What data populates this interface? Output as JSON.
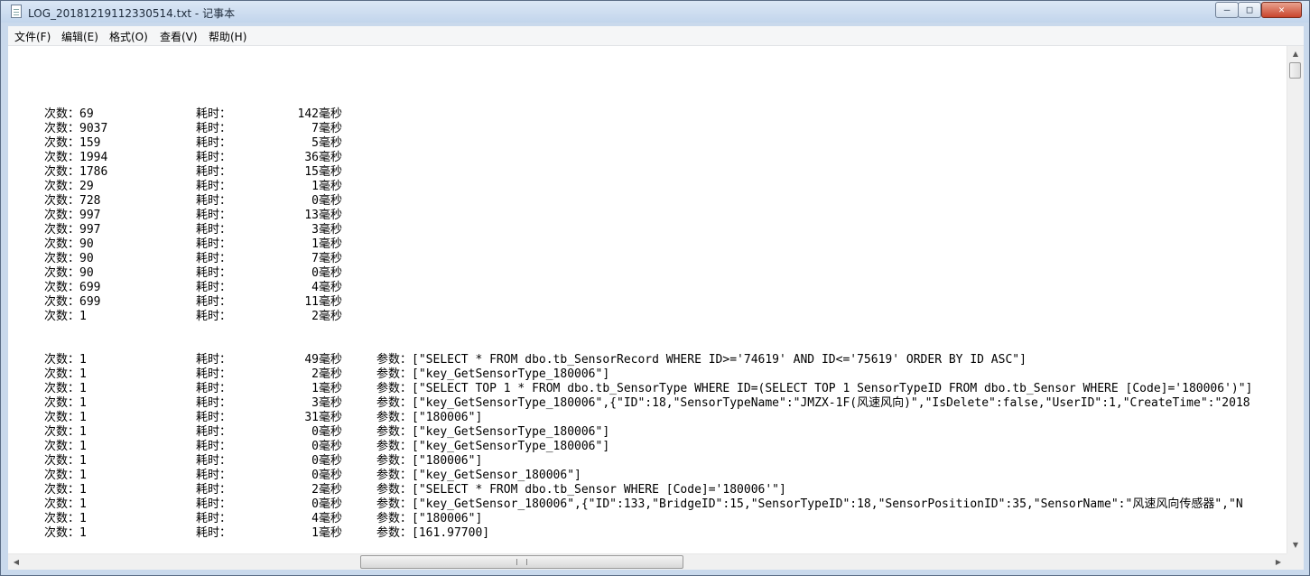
{
  "window": {
    "title": "LOG_20181219112330514.txt - 记事本",
    "controls": {
      "minimize": "‒",
      "maximize": "□",
      "close": "✕"
    }
  },
  "menu": [
    "文件(F)",
    "编辑(E)",
    "格式(O)",
    "查看(V)",
    "帮助(H)"
  ],
  "log": {
    "count_prefix": "次数：",
    "time_label": "耗时：",
    "time_unit": "毫秒",
    "param_label": "参数：",
    "summary": [
      {
        "count": "69",
        "ms": "142"
      },
      {
        "count": "9037",
        "ms": "7"
      },
      {
        "count": "159",
        "ms": "5"
      },
      {
        "count": "1994",
        "ms": "36"
      },
      {
        "count": "1786",
        "ms": "15"
      },
      {
        "count": "29",
        "ms": "1"
      },
      {
        "count": "728",
        "ms": "0"
      },
      {
        "count": "997",
        "ms": "13"
      },
      {
        "count": "997",
        "ms": "3"
      },
      {
        "count": "90",
        "ms": "1"
      },
      {
        "count": "90",
        "ms": "7"
      },
      {
        "count": "90",
        "ms": "0"
      },
      {
        "count": "699",
        "ms": "4"
      },
      {
        "count": "699",
        "ms": "11"
      },
      {
        "count": "1",
        "ms": "2"
      }
    ],
    "details": [
      {
        "count": "1",
        "ms": "49",
        "param": "[\"SELECT * FROM dbo.tb_SensorRecord WHERE ID>='74619' AND ID<='75619' ORDER BY ID ASC\"]"
      },
      {
        "count": "1",
        "ms": "2",
        "param": "[\"key_GetSensorType_180006\"]"
      },
      {
        "count": "1",
        "ms": "1",
        "param": "[\"SELECT TOP 1 * FROM dbo.tb_SensorType WHERE ID=(SELECT TOP 1 SensorTypeID FROM dbo.tb_Sensor WHERE [Code]='180006')\"]"
      },
      {
        "count": "1",
        "ms": "3",
        "param": "[\"key_GetSensorType_180006\",{\"ID\":18,\"SensorTypeName\":\"JMZX-1F(风速风向)\",\"IsDelete\":false,\"UserID\":1,\"CreateTime\":\"2018"
      },
      {
        "count": "1",
        "ms": "31",
        "param": "[\"180006\"]"
      },
      {
        "count": "1",
        "ms": "0",
        "param": "[\"key_GetSensorType_180006\"]"
      },
      {
        "count": "1",
        "ms": "0",
        "param": "[\"key_GetSensorType_180006\"]"
      },
      {
        "count": "1",
        "ms": "0",
        "param": "[\"180006\"]"
      },
      {
        "count": "1",
        "ms": "0",
        "param": "[\"key_GetSensor_180006\"]"
      },
      {
        "count": "1",
        "ms": "2",
        "param": "[\"SELECT * FROM dbo.tb_Sensor WHERE [Code]='180006'\"]"
      },
      {
        "count": "1",
        "ms": "0",
        "param": "[\"key_GetSensor_180006\",{\"ID\":133,\"BridgeID\":15,\"SensorTypeID\":18,\"SensorPositionID\":35,\"SensorName\":\"风速风向传感器\",\"N"
      },
      {
        "count": "1",
        "ms": "4",
        "param": "[\"180006\"]"
      },
      {
        "count": "1",
        "ms": "1",
        "param": "[161.97700]"
      }
    ]
  },
  "scrollbars": {
    "up": "▲",
    "down": "▼",
    "left": "◀",
    "right": "▶"
  }
}
